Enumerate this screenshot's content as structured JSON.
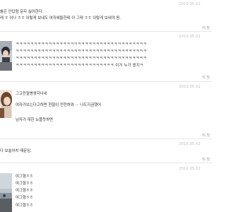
{
  "entries": [
    {
      "lines": [
        "를은 단답형 문자 싫어한다",
        "래 ㅎ 이나 ㅎㅎ 이렇게 보내도 여자애들한테 이 그래 ㅎㅎ 이렇게 보내야 됨."
      ],
      "date": "2010.05.02 ",
      "reply": "이 짓"
    },
    {
      "lines": [
        "ㅋㅋㅋㅋㅋㅋㅋㅋㅋㅋㅋㅋㅋㅋㅋㅋㅋㅋㅋㅋㅋㅋㅋㅋㅋㅋㅋㅋㅋㅋㅋㅋㅋㅋㅋㅋ",
        "ㅋㅋㅋㅋㅋㅋㅋㅋㅋㅋㅋㅋㅋㅋㅋㅋㅋㅋㅋㅋㅋㅋㅋㅋㅋㅋㅋㅋㅋㅋㅋㅋㅋㅋㅋㅋ",
        "ㅋㅋㅋㅋㅋㅋㅋㅋㅋㅋㅋㅋㅋㅋㅋㅋㅋㅋㅋㅋㅋㅋㅋㅋㅋㅋㅋㅋㅋㅋㅋㅋㅋㅋㅋㅋ",
        "ㅋㅋㅋㅋㅋㅋㅋㅋㅋㅋㅋㅋㅋㅋㅋㅋㅋㅋㅋㅋㅋㅋㅋㅋㅋㅋㅋ 이거 누가 썼지ㅋ"
      ],
      "date": "2010.05.02 ",
      "reply": "이 짓"
    },
    {
      "lines": [
        "그고전절병생각나네",
        "여자가보는다고하면 현철이 전전하와 ··· 나도지금했어",
        "남자가 대한 뇨플듯하면"
      ],
      "date": "2010.05.02 ",
      "reply": "이 짓"
    },
    {
      "lines": [
        "다 보슬아치 때문임."
      ],
      "date": "2010.05.02 ",
      "reply": "이 짓"
    },
    {
      "lines": [
        "여그형ㅎㅎ",
        "여그형ㅎㅎ",
        "여그형ㅎㅎ",
        "여그형ㅎㅎ",
        "여그형ㅎㅎ"
      ],
      "date": "2010.05.02 ",
      "reply": ""
    }
  ]
}
